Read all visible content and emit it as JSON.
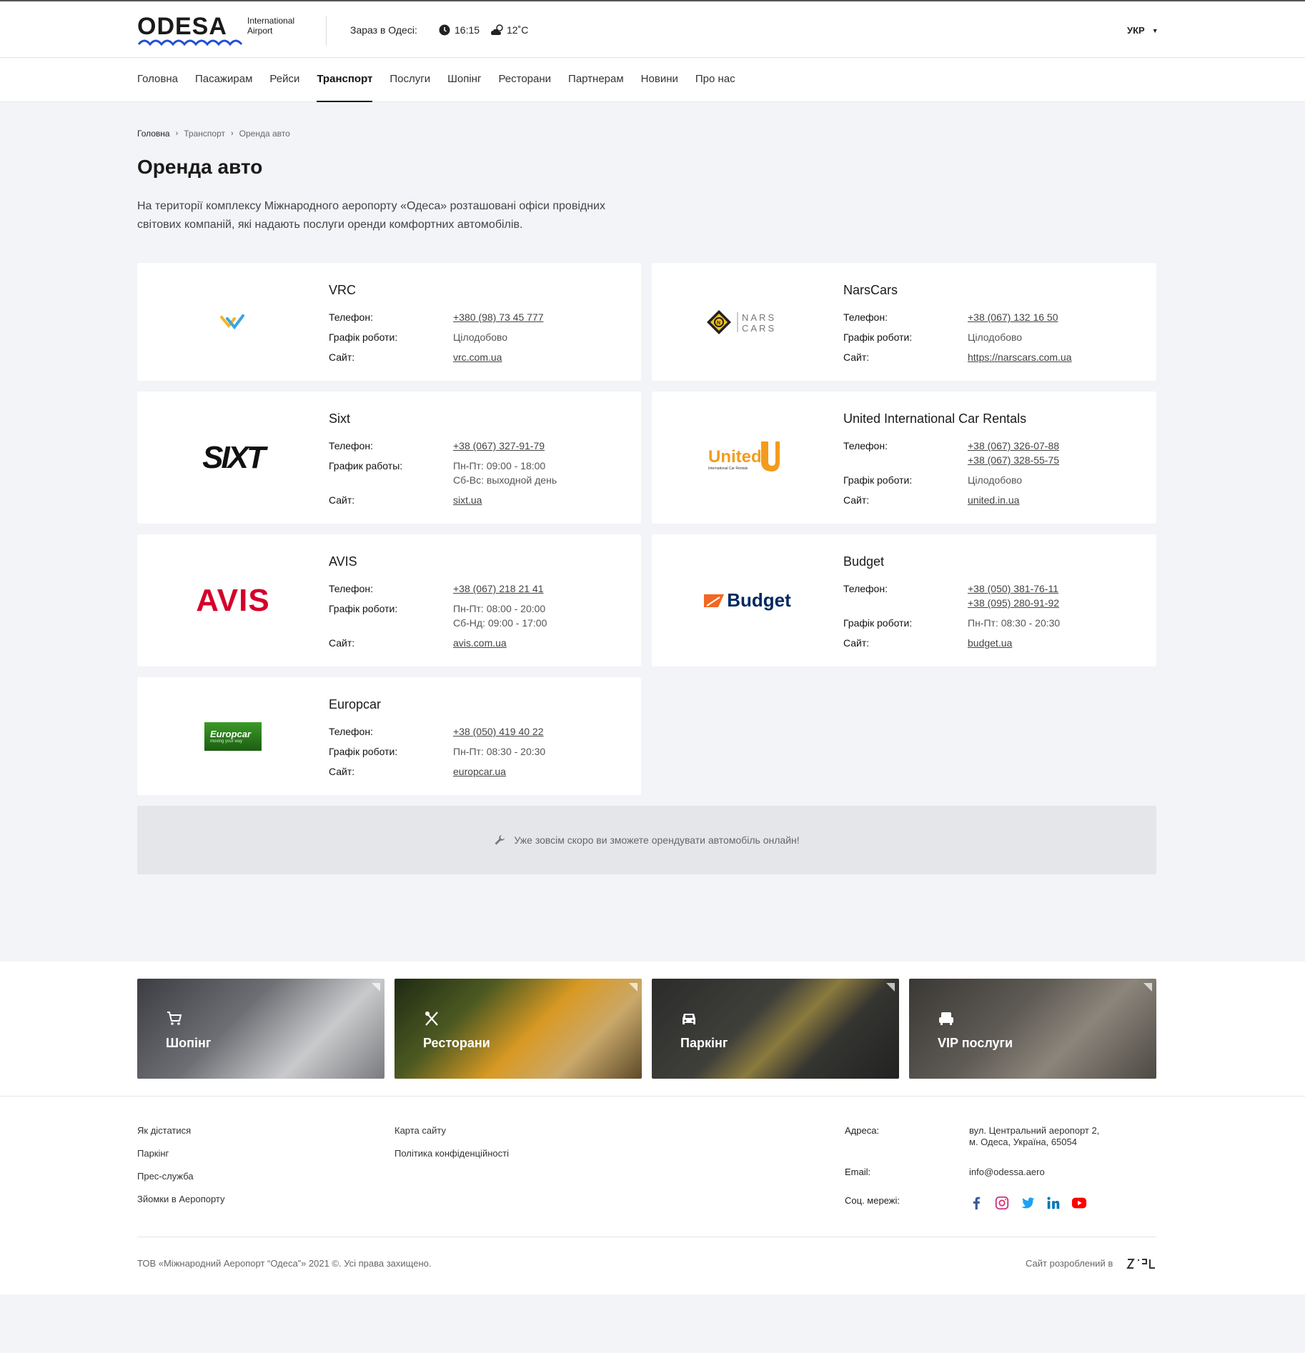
{
  "header": {
    "logo_text": "ODESA",
    "logo_sub_1": "International",
    "logo_sub_2": "Airport",
    "now_label": "Зараз в Одесі:",
    "time": "16:15",
    "temperature": "12˚C",
    "language": "УКР"
  },
  "nav": [
    "Головна",
    "Пасажирам",
    "Рейси",
    "Транспорт",
    "Послуги",
    "Шопінг",
    "Ресторани",
    "Партнерам",
    "Новини",
    "Про нас"
  ],
  "breadcrumb": [
    "Головна",
    "Транспорт",
    "Оренда авто"
  ],
  "page": {
    "title": "Оренда авто",
    "intro": "На території комплексу Міжнародного аеропорту «Одеса» розташовані офіси провідних світових компаній, які надають послуги оренди комфортних автомобілів."
  },
  "companies": [
    {
      "name": "VRC",
      "rows": [
        {
          "label": "Телефон:",
          "values": [
            "+380 (98) 73 45 777"
          ],
          "link": true
        },
        {
          "label": "Графік роботи:",
          "values": [
            "Цілодобово"
          ],
          "link": false
        },
        {
          "label": "Сайт:",
          "values": [
            "vrc.com.ua"
          ],
          "link": true
        }
      ]
    },
    {
      "name": "NarsCars",
      "logo_text_1": "NARS",
      "logo_text_2": "CARS",
      "rows": [
        {
          "label": "Телефон:",
          "values": [
            "+38 (067) 132 16 50"
          ],
          "link": true
        },
        {
          "label": "Графік роботи:",
          "values": [
            "Цілодобово"
          ],
          "link": false
        },
        {
          "label": "Сайт:",
          "values": [
            "https://narscars.com.ua"
          ],
          "link": true
        }
      ]
    },
    {
      "name": "Sixt",
      "logo_text": "SIXT",
      "rows": [
        {
          "label": "Телефон:",
          "values": [
            "+38 (067) 327-91-79"
          ],
          "link": true
        },
        {
          "label": "График работы:",
          "values": [
            "Пн-Пт: 09:00 - 18:00",
            "Сб-Вс: выходной день"
          ],
          "link": false
        },
        {
          "label": "Сайт:",
          "values": [
            "sixt.ua"
          ],
          "link": true
        }
      ]
    },
    {
      "name": "United International Car Rentals",
      "logo_text": "United",
      "logo_sub": "International Car Rentals",
      "rows": [
        {
          "label": "Телефон:",
          "values": [
            "+38 (067) 326-07-88",
            "+38 (067) 328-55-75"
          ],
          "link": true
        },
        {
          "label": "Графік роботи:",
          "values": [
            "Цілодобово"
          ],
          "link": false
        },
        {
          "label": "Сайт:",
          "values": [
            "united.in.ua"
          ],
          "link": true
        }
      ]
    },
    {
      "name": "AVIS",
      "logo_text": "AVIS",
      "rows": [
        {
          "label": "Телефон:",
          "values": [
            "+38 (067) 218 21 41"
          ],
          "link": true
        },
        {
          "label": "Графік роботи:",
          "values": [
            "Пн-Пт: 08:00 - 20:00",
            "Сб-Нд: 09:00 - 17:00"
          ],
          "link": false
        },
        {
          "label": "Сайт:",
          "values": [
            "avis.com.ua"
          ],
          "link": true
        }
      ]
    },
    {
      "name": "Budget",
      "logo_text": "Budget",
      "rows": [
        {
          "label": "Телефон:",
          "values": [
            "+38 (050) 381-76-11",
            "+38 (095) 280-91-92"
          ],
          "link": true
        },
        {
          "label": "Графік роботи:",
          "values": [
            "Пн-Пт: 08:30 - 20:30"
          ],
          "link": false
        },
        {
          "label": "Сайт:",
          "values": [
            "budget.ua"
          ],
          "link": true
        }
      ]
    },
    {
      "name": "Europcar",
      "logo_text": "Europcar",
      "logo_sub": "moving your way",
      "rows": [
        {
          "label": "Телефон:",
          "values": [
            "+38 (050) 419 40 22"
          ],
          "link": true
        },
        {
          "label": "Графік роботи:",
          "values": [
            "Пн-Пт: 08:30 - 20:30"
          ],
          "link": false
        },
        {
          "label": "Сайт:",
          "values": [
            "europcar.ua"
          ],
          "link": true
        }
      ]
    }
  ],
  "notice": "Уже зовсім скоро ви зможете орендувати автомобіль онлайн!",
  "tiles": [
    {
      "label": "Шопінг",
      "icon": "cart-icon"
    },
    {
      "label": "Ресторани",
      "icon": "cutlery-icon"
    },
    {
      "label": "Паркінг",
      "icon": "car-icon"
    },
    {
      "label": "VIP послуги",
      "icon": "armchair-icon"
    }
  ],
  "footer": {
    "col1": [
      "Як дістатися",
      "Паркінг",
      "Прес-служба",
      "Зйомки в Аеропорту"
    ],
    "col2": [
      "Карта сайту",
      "Політика конфіденційності"
    ],
    "address_label": "Адреса:",
    "address_line1": "вул. Центральний аеропорт 2,",
    "address_line2": "м. Одеса, Україна, 65054",
    "email_label": "Email:",
    "email": "info@odessa.aero",
    "social_label": "Соц. мережі:",
    "socials": [
      "facebook-icon",
      "instagram-icon",
      "twitter-icon",
      "linkedin-icon",
      "youtube-icon"
    ],
    "copyright": "ТОВ «Міжнародний Аеропорт “Одеса”» 2021 ©. Усі права захищено.",
    "developer": "Сайт розроблений в"
  },
  "colors": {
    "page_bg": "#f3f4f7",
    "accent_blue": "#1f4fd6",
    "avis_red": "#d4002a",
    "budget_orange": "#f26722",
    "budget_blue": "#00285f",
    "united_orange": "#f49b1d",
    "europcar_green": "#2f8a1e"
  }
}
